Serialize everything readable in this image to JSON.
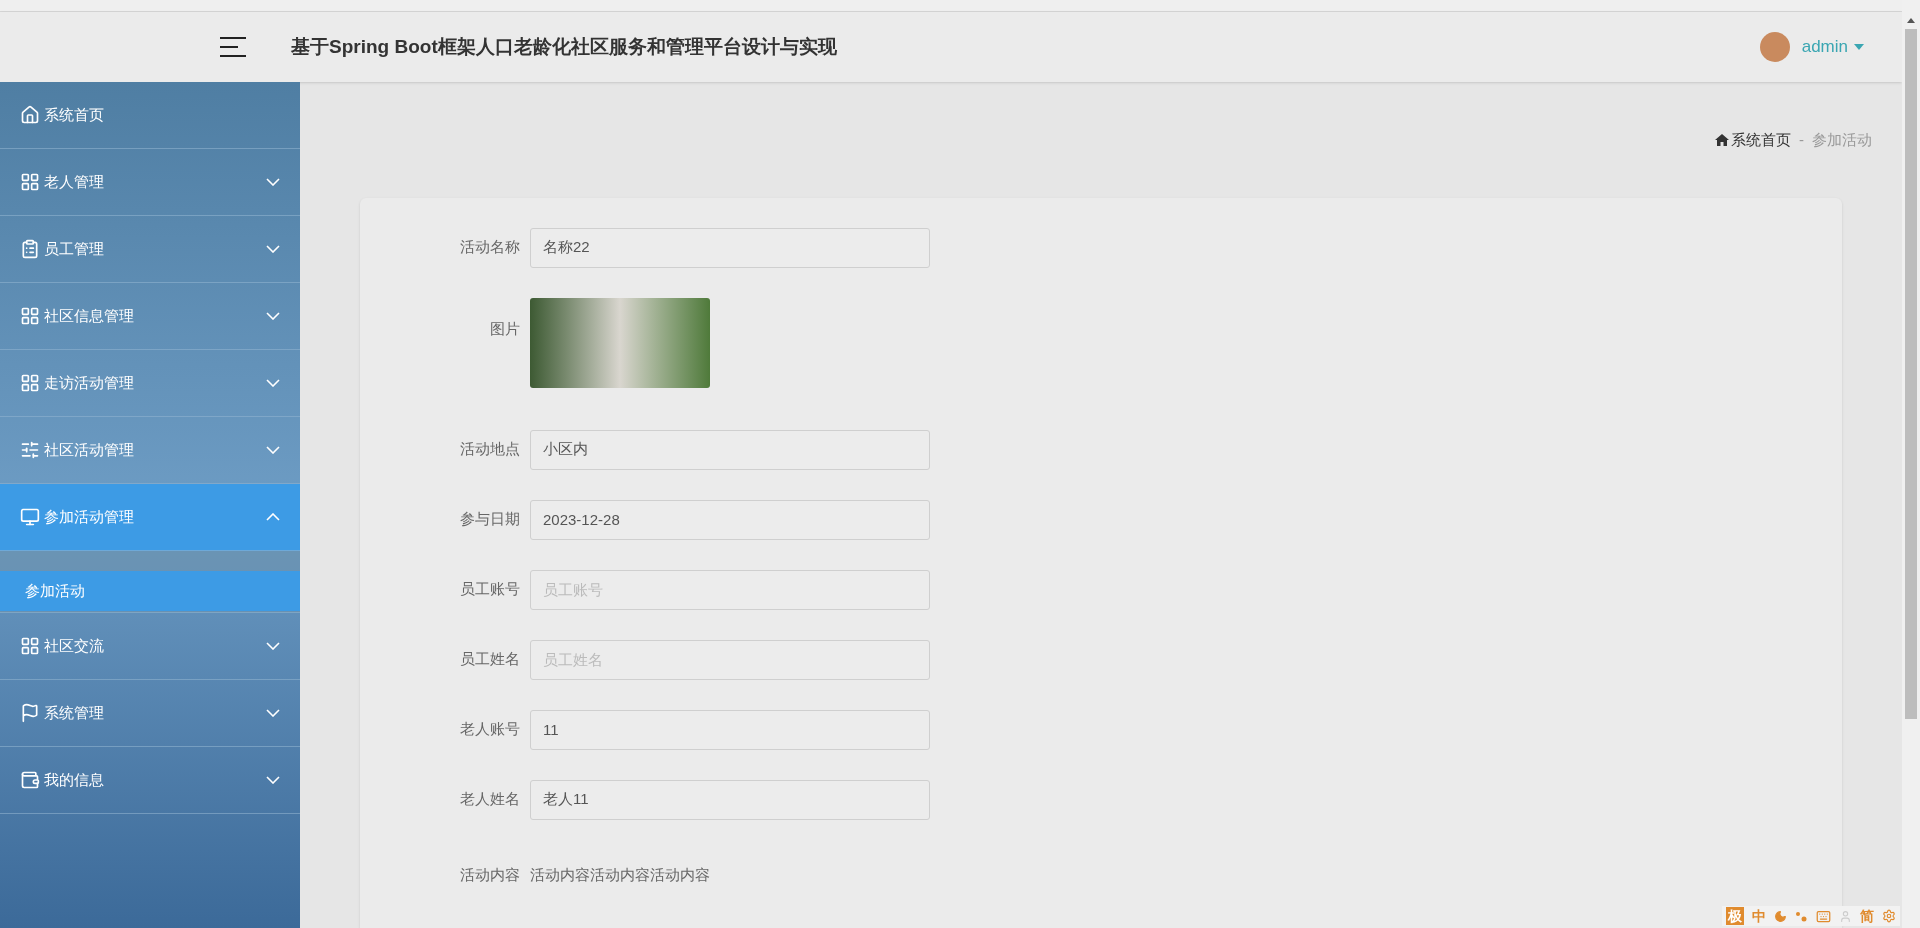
{
  "header": {
    "title": "基于Spring Boot框架人口老龄化社区服务和管理平台设计与实现",
    "user": "admin"
  },
  "sidebar": {
    "items": [
      {
        "label": "系统首页",
        "kind": "link",
        "selected": false
      },
      {
        "label": "老人管理",
        "kind": "menu",
        "selected": false,
        "expanded": false
      },
      {
        "label": "员工管理",
        "kind": "menu",
        "selected": false,
        "expanded": false
      },
      {
        "label": "社区信息管理",
        "kind": "menu",
        "selected": false,
        "expanded": false
      },
      {
        "label": "走访活动管理",
        "kind": "menu",
        "selected": false,
        "expanded": false
      },
      {
        "label": "社区活动管理",
        "kind": "menu",
        "selected": false,
        "expanded": false
      },
      {
        "label": "参加活动管理",
        "kind": "menu",
        "selected": true,
        "expanded": true,
        "children": [
          {
            "label": "参加活动",
            "selected": true
          }
        ]
      },
      {
        "label": "社区交流",
        "kind": "menu",
        "selected": false,
        "expanded": false
      },
      {
        "label": "系统管理",
        "kind": "menu",
        "selected": false,
        "expanded": false
      },
      {
        "label": "我的信息",
        "kind": "menu",
        "selected": false,
        "expanded": false
      }
    ]
  },
  "breadcrumb": {
    "home": "系统首页",
    "separator": "-",
    "current": "参加活动"
  },
  "form": {
    "fields": [
      {
        "label": "活动名称",
        "kind": "input",
        "value": "名称22"
      },
      {
        "label": "图片",
        "kind": "image"
      },
      {
        "label": "活动地点",
        "kind": "input",
        "value": "小区内"
      },
      {
        "label": "参与日期",
        "kind": "input",
        "value": "2023-12-28"
      },
      {
        "label": "员工账号",
        "kind": "input",
        "placeholder": "员工账号"
      },
      {
        "label": "员工姓名",
        "kind": "input",
        "placeholder": "员工姓名"
      },
      {
        "label": "老人账号",
        "kind": "input",
        "value": "11"
      },
      {
        "label": "老人姓名",
        "kind": "input",
        "value": "老人11"
      },
      {
        "label": "活动内容",
        "kind": "text",
        "value": "活动内容活动内容活动内容"
      }
    ]
  },
  "ime_toolbar": {
    "items": [
      "极",
      "中",
      "简"
    ]
  }
}
